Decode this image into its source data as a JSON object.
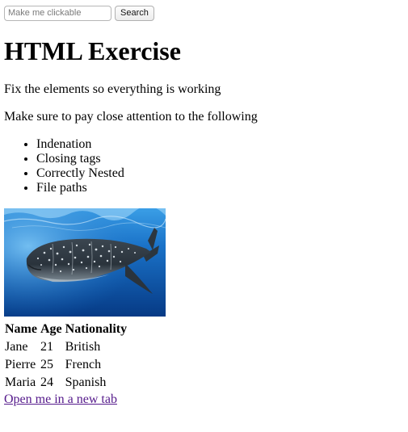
{
  "search": {
    "placeholder": "Make me clickable",
    "button_label": "Search"
  },
  "title": "HTML Exercise",
  "paragraphs": [
    "Fix the elements so everything is working",
    "Make sure to pay close attention to the following"
  ],
  "checklist": [
    "Indenation",
    "Closing tags",
    "Correctly Nested",
    "File paths"
  ],
  "table": {
    "headers": [
      "Name",
      "Age",
      "Nationality"
    ],
    "rows": [
      [
        "Jane",
        "21",
        "British"
      ],
      [
        "Pierre",
        "25",
        "French"
      ],
      [
        "Maria",
        "24",
        "Spanish"
      ]
    ]
  },
  "link_text": "Open me in a new tab",
  "colors": {
    "link_visited": "#551a8b",
    "ocean_deep": "#063a85",
    "ocean_light": "#3fa6e8"
  }
}
